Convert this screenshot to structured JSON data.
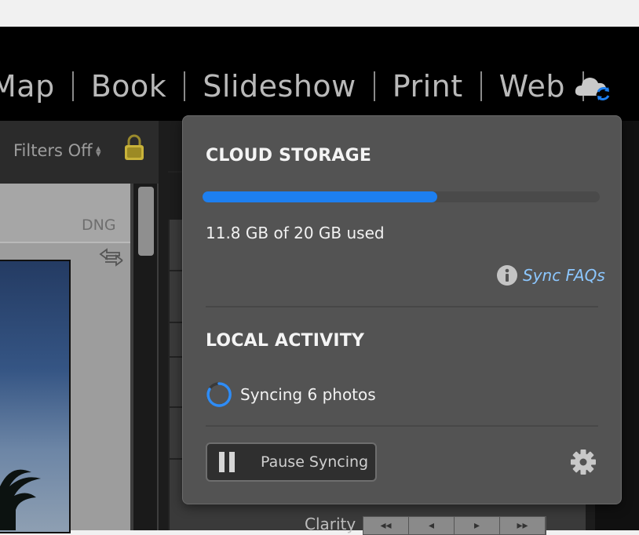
{
  "header": {
    "modules": [
      "Map",
      "Book",
      "Slideshow",
      "Print",
      "Web"
    ],
    "cloud_icon": "cloud-sync-icon"
  },
  "library": {
    "filters_label": "Filters Off",
    "file_type": "DNG"
  },
  "develop": {
    "clarity_label": "Clarity",
    "clarity_buttons": [
      "◂◂",
      "◂",
      "▸",
      "▸▸"
    ]
  },
  "popover": {
    "cloud_storage_title": "CLOUD STORAGE",
    "storage_used_fraction": 0.59,
    "usage_text": "11.8 GB of 20 GB used",
    "sync_faqs_label": "Sync FAQs",
    "local_activity_title": "LOCAL ACTIVITY",
    "syncing_text": "Syncing 6 photos",
    "pause_button_label": "Pause Syncing"
  },
  "colors": {
    "accent": "#1d7ff0",
    "link": "#8cc7ff",
    "popover_bg": "#535353"
  }
}
